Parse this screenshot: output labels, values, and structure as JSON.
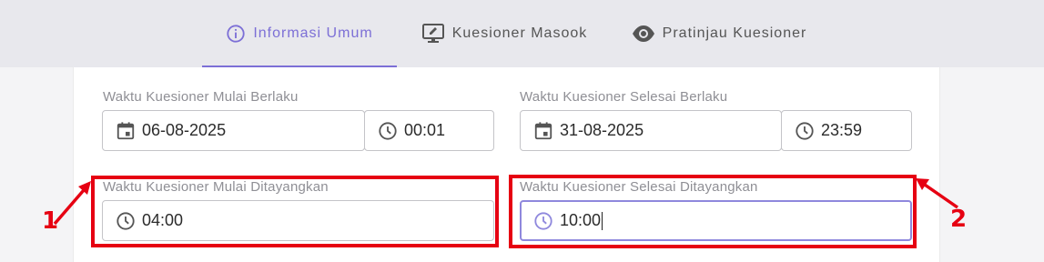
{
  "tabs": [
    {
      "label": "Informasi Umum",
      "icon": "info-icon",
      "active": true
    },
    {
      "label": "Kuesioner Masook",
      "icon": "monitor-edit-icon",
      "active": false
    },
    {
      "label": "Pratinjau Kuesioner",
      "icon": "eye-icon",
      "active": false
    }
  ],
  "form": {
    "start_valid": {
      "label": "Waktu Kuesioner Mulai Berlaku",
      "date": "06-08-2025",
      "time": "00:01"
    },
    "end_valid": {
      "label": "Waktu Kuesioner Selesai Berlaku",
      "date": "31-08-2025",
      "time": "23:59"
    },
    "start_shown": {
      "label": "Waktu Kuesioner Mulai Ditayangkan",
      "time": "04:00"
    },
    "end_shown": {
      "label": "Waktu Kuesioner Selesai Ditayangkan",
      "time": "10:00"
    }
  },
  "annotations": {
    "marker_1": "1",
    "marker_2": "2"
  },
  "colors": {
    "accent": "#7c6fd6",
    "highlight": "#e60012",
    "tabbar_bg": "#e8e8ed"
  }
}
